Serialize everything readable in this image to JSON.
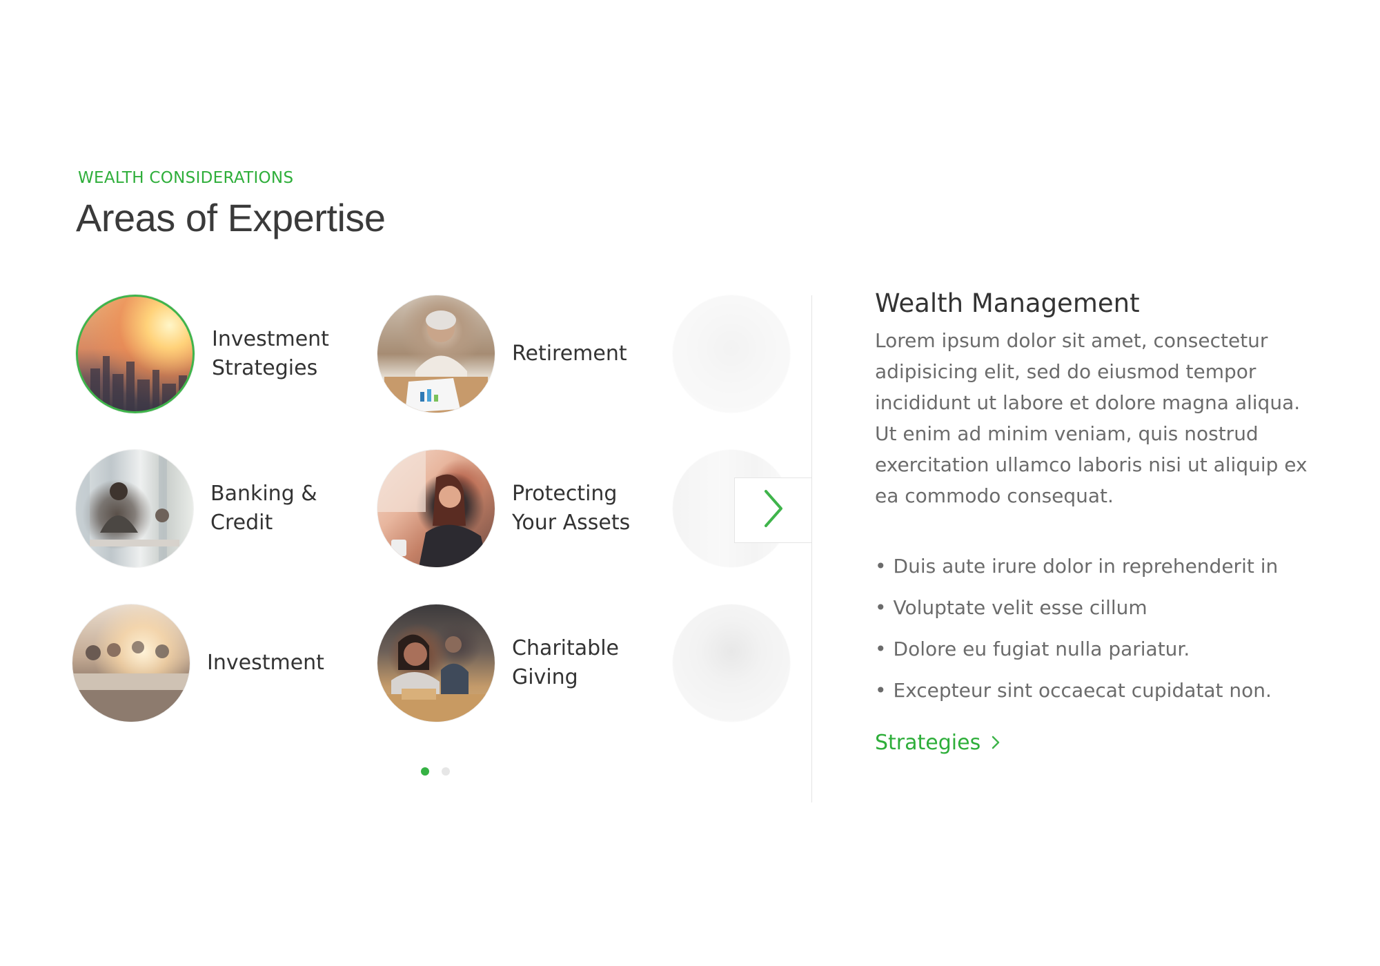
{
  "section": {
    "eyebrow": "WEALTH CONSIDERATIONS",
    "title": "Areas of Expertise"
  },
  "tiles": [
    {
      "label": "Investment Strategies",
      "icon": "city-skyline-photo",
      "active": true
    },
    {
      "label": "Retirement",
      "icon": "senior-woman-photo",
      "active": false
    },
    {
      "label": "Banking & Credit",
      "icon": "office-meeting-photo",
      "active": false
    },
    {
      "label": "Protecting Your Assets",
      "icon": "woman-on-phone-photo",
      "active": false
    },
    {
      "label": "Investment",
      "icon": "seminar-photo",
      "active": false
    },
    {
      "label": "Charitable Giving",
      "icon": "volunteers-photo",
      "active": false
    }
  ],
  "carousel": {
    "next_icon": "chevron-right-icon",
    "pages": 2,
    "current_page": 1
  },
  "detail": {
    "title": "Wealth Management",
    "body": "Lorem ipsum dolor sit amet, consectetur adipisicing elit, sed do eiusmod tempor incididunt ut labore et dolore magna aliqua. Ut enim ad minim veniam, quis nostrud exercitation ullamco laboris nisi ut aliquip ex ea commodo consequat.",
    "bullets": [
      "Duis aute irure dolor in reprehenderit in",
      "Voluptate velit esse cillum",
      "Dolore eu fugiat nulla pariatur.",
      "Excepteur sint occaecat cupidatat non."
    ],
    "link_label": "Strategies",
    "link_icon": "chevron-right-icon"
  },
  "colors": {
    "accent": "#3fb44b",
    "heading": "#3a3a3a",
    "body_text": "#6b6b6b"
  }
}
